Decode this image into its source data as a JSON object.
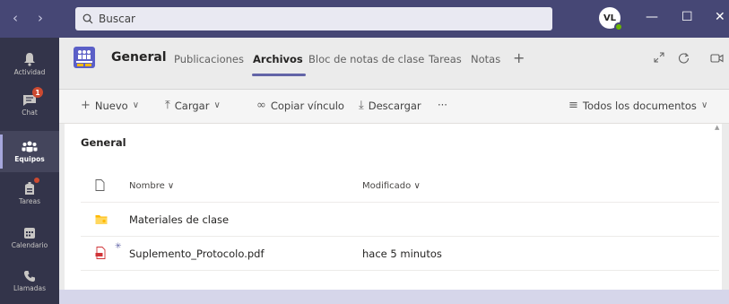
{
  "titlebar": {
    "search_placeholder": "Buscar",
    "avatar_initials": "VL",
    "back_glyph": "‹",
    "forward_glyph": "›",
    "minimize_glyph": "—",
    "maximize_glyph": "☐",
    "close_glyph": "✕"
  },
  "rail": [
    {
      "label": "Actividad",
      "icon": "bell-icon"
    },
    {
      "label": "Chat",
      "icon": "chat-icon",
      "badge": "1"
    },
    {
      "label": "Equipos",
      "icon": "teams-icon",
      "active": true
    },
    {
      "label": "Tareas",
      "icon": "assignments-icon",
      "dot": true
    },
    {
      "label": "Calendario",
      "icon": "calendar-icon"
    },
    {
      "label": "Llamadas",
      "icon": "phone-icon"
    }
  ],
  "channel": {
    "title": "General",
    "tabs": [
      "Publicaciones",
      "Archivos",
      "Bloc de notas de clase",
      "Tareas",
      "Notas"
    ],
    "active_tab": "Archivos",
    "add_tab_glyph": "+"
  },
  "toolbar": {
    "new": "Nuevo",
    "upload": "Cargar",
    "copy_link": "Copiar vínculo",
    "download": "Descargar",
    "more": "···",
    "view": "Todos los documentos"
  },
  "files": {
    "section_title": "General",
    "col_name": "Nombre",
    "col_modified": "Modificado",
    "rows": [
      {
        "name": "Materiales de clase",
        "modified": "",
        "type": "folder"
      },
      {
        "name": "Suplemento_Protocolo.pdf",
        "modified": "hace 5 minutos",
        "type": "pdf"
      }
    ]
  },
  "colors": {
    "titlebar": "#464775",
    "rail": "#33344a",
    "accent": "#6264a7",
    "badge": "#cc4a31"
  }
}
